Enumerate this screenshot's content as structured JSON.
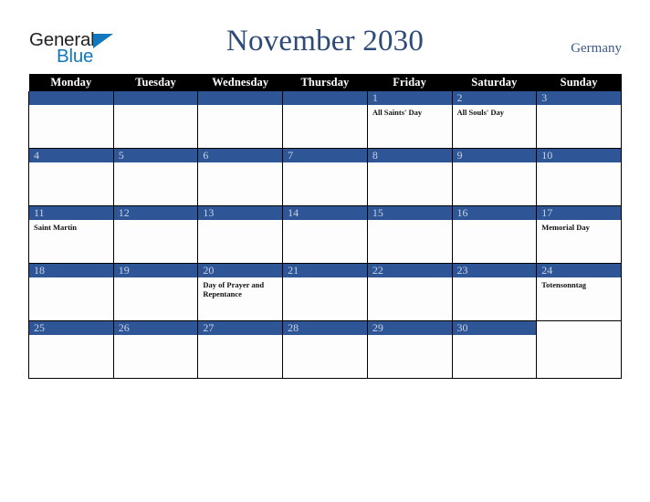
{
  "logo": {
    "word_one": "General",
    "word_two": "Blue",
    "triangle_icon": "triangle-icon",
    "brand_blue": "#1278be",
    "brand_black": "#231f20"
  },
  "header": {
    "title": "November 2030",
    "country": "Germany",
    "title_color": "#2e4a78",
    "country_color": "#3c5a86"
  },
  "calendar": {
    "accent_blue": "#2e5596",
    "header_bg": "#000000",
    "weekday_headers": [
      "Monday",
      "Tuesday",
      "Wednesday",
      "Thursday",
      "Friday",
      "Saturday",
      "Sunday"
    ],
    "weeks": [
      [
        {
          "day": "",
          "event": "",
          "bar": true
        },
        {
          "day": "",
          "event": "",
          "bar": true
        },
        {
          "day": "",
          "event": "",
          "bar": true
        },
        {
          "day": "",
          "event": "",
          "bar": true
        },
        {
          "day": "1",
          "event": "All Saints' Day",
          "bar": true
        },
        {
          "day": "2",
          "event": "All Souls' Day",
          "bar": true
        },
        {
          "day": "3",
          "event": "",
          "bar": true
        }
      ],
      [
        {
          "day": "4",
          "event": "",
          "bar": true
        },
        {
          "day": "5",
          "event": "",
          "bar": true
        },
        {
          "day": "6",
          "event": "",
          "bar": true
        },
        {
          "day": "7",
          "event": "",
          "bar": true
        },
        {
          "day": "8",
          "event": "",
          "bar": true
        },
        {
          "day": "9",
          "event": "",
          "bar": true
        },
        {
          "day": "10",
          "event": "",
          "bar": true
        }
      ],
      [
        {
          "day": "11",
          "event": "Saint Martin",
          "bar": true
        },
        {
          "day": "12",
          "event": "",
          "bar": true
        },
        {
          "day": "13",
          "event": "",
          "bar": true
        },
        {
          "day": "14",
          "event": "",
          "bar": true
        },
        {
          "day": "15",
          "event": "",
          "bar": true
        },
        {
          "day": "16",
          "event": "",
          "bar": true
        },
        {
          "day": "17",
          "event": "Memorial Day",
          "bar": true
        }
      ],
      [
        {
          "day": "18",
          "event": "",
          "bar": true
        },
        {
          "day": "19",
          "event": "",
          "bar": true
        },
        {
          "day": "20",
          "event": "Day of Prayer and Repentance",
          "bar": true
        },
        {
          "day": "21",
          "event": "",
          "bar": true
        },
        {
          "day": "22",
          "event": "",
          "bar": true
        },
        {
          "day": "23",
          "event": "",
          "bar": true
        },
        {
          "day": "24",
          "event": "Totensonntag",
          "bar": true
        }
      ],
      [
        {
          "day": "25",
          "event": "",
          "bar": true
        },
        {
          "day": "26",
          "event": "",
          "bar": true
        },
        {
          "day": "27",
          "event": "",
          "bar": true
        },
        {
          "day": "28",
          "event": "",
          "bar": true
        },
        {
          "day": "29",
          "event": "",
          "bar": true
        },
        {
          "day": "30",
          "event": "",
          "bar": true
        },
        {
          "day": "",
          "event": "",
          "bar": false
        }
      ]
    ]
  }
}
